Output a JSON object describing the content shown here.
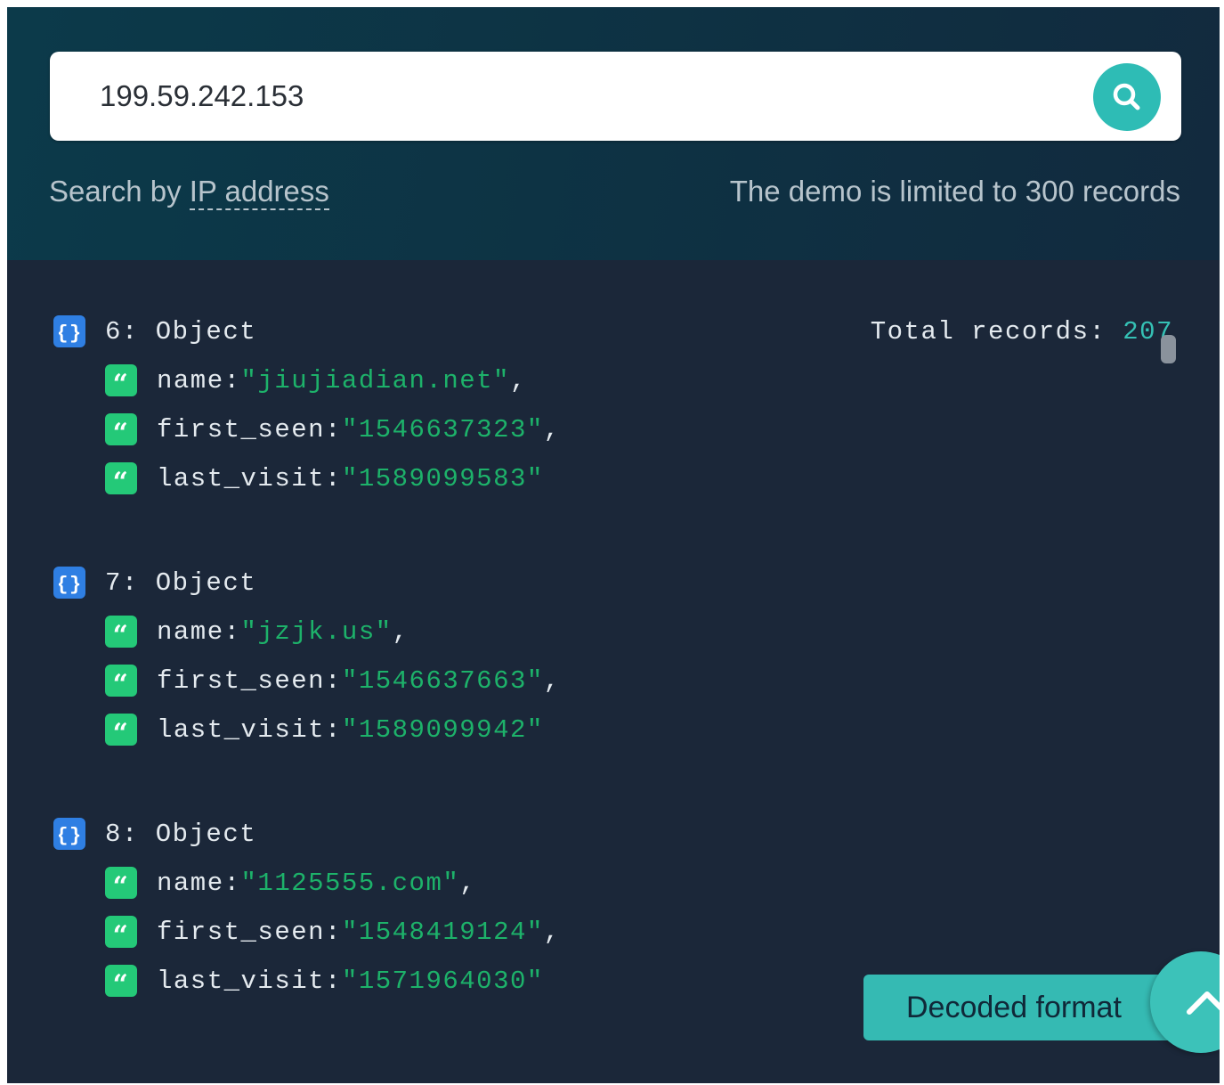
{
  "search": {
    "value": "199.59.242.153",
    "hint_prefix": "Search by ",
    "hint_link": "IP address",
    "limit_note": "The demo is limited to 300 records"
  },
  "results": {
    "total_label": "Total records: ",
    "total_value": "207",
    "records": [
      {
        "header": "6: Object",
        "name_key": "name: ",
        "name_value": "\"jiujiadian.net\"",
        "name_sep": ",",
        "first_key": "first_seen: ",
        "first_value": "\"1546637323\"",
        "first_sep": ",",
        "last_key": "last_visit: ",
        "last_value": "\"1589099583\""
      },
      {
        "header": "7: Object",
        "name_key": "name: ",
        "name_value": "\"jzjk.us\"",
        "name_sep": ",",
        "first_key": "first_seen: ",
        "first_value": "\"1546637663\"",
        "first_sep": ",",
        "last_key": "last_visit: ",
        "last_value": "\"1589099942\""
      },
      {
        "header": "8: Object",
        "name_key": "name: ",
        "name_value": "\"1125555.com\"",
        "name_sep": ",",
        "first_key": "first_seen: ",
        "first_value": "\"1548419124\"",
        "first_sep": ",",
        "last_key": "last_visit: ",
        "last_value": "\"1571964030\""
      }
    ]
  },
  "actions": {
    "decoded_format": "Decoded format"
  },
  "icons": {
    "search": "search-icon",
    "object": "object-braces-icon",
    "string": "quote-icon",
    "scroll_top": "chevron-up-icon"
  },
  "colors": {
    "accent": "#2ebcb5",
    "panel_bg": "#1b2739",
    "string_value": "#1db26a",
    "object_icon": "#2f7fe3",
    "string_icon": "#24c978"
  }
}
